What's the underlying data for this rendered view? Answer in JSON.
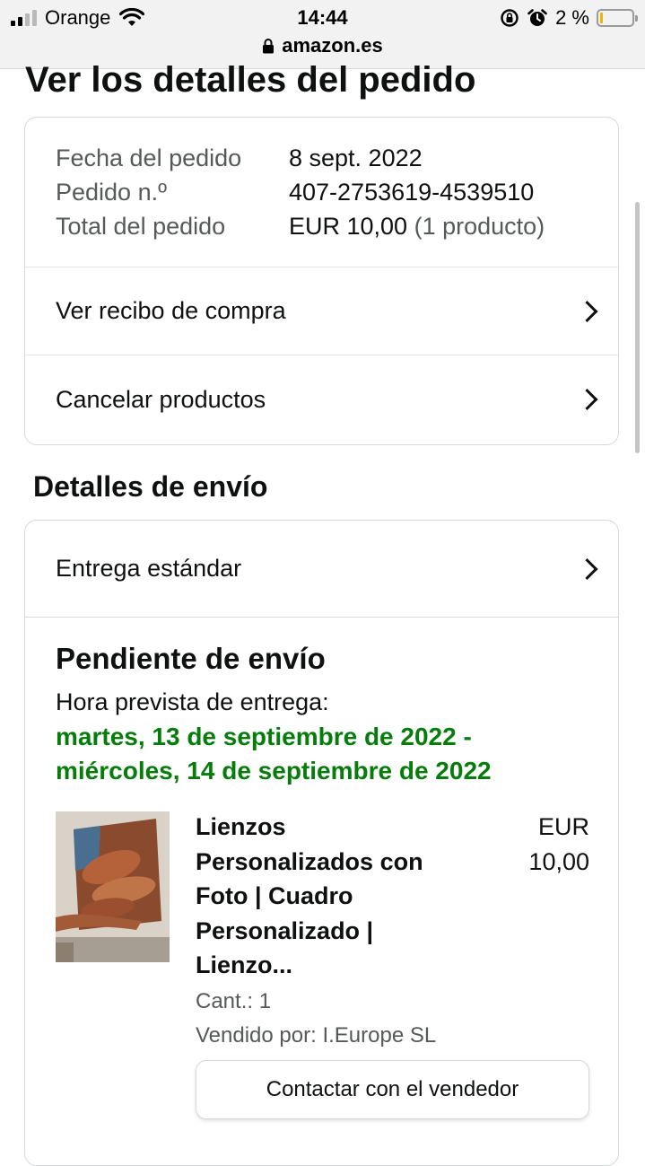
{
  "status_bar": {
    "carrier": "Orange",
    "time": "14:44",
    "battery_percent": "2 %",
    "battery_level": 0.02,
    "url": "amazon.es"
  },
  "page": {
    "title": "Ver los detalles del pedido"
  },
  "order_summary": {
    "date_label": "Fecha del pedido",
    "date_value": "8 sept. 2022",
    "number_label": "Pedido n.º",
    "number_value": "407-2753619-4539510",
    "total_label": "Total del pedido",
    "total_value": "EUR 10,00",
    "total_items": "(1 producto)",
    "receipt_link": "Ver recibo de compra",
    "cancel_link": "Cancelar productos"
  },
  "shipping": {
    "section_title": "Detalles de envío",
    "method": "Entrega estándar",
    "status": "Pendiente de envío",
    "eta_label": "Hora prevista de entrega:",
    "eta_line1": "martes, 13 de septiembre de 2022 -",
    "eta_line2": "miércoles, 14 de septiembre de 2022",
    "product": {
      "title_lines": [
        "Lienzos",
        "Personalizados con",
        "Foto | Cuadro",
        "Personalizado |",
        "Lienzo..."
      ],
      "price_currency": "EUR",
      "price_amount": "10,00",
      "quantity": "Cant.: 1",
      "seller": "Vendido por: I.Europe SL"
    },
    "contact_button": "Contactar con el vendedor"
  },
  "colors": {
    "delivery_green": "#067d0b",
    "border": "#d5d9d9",
    "muted_text": "#565959"
  }
}
